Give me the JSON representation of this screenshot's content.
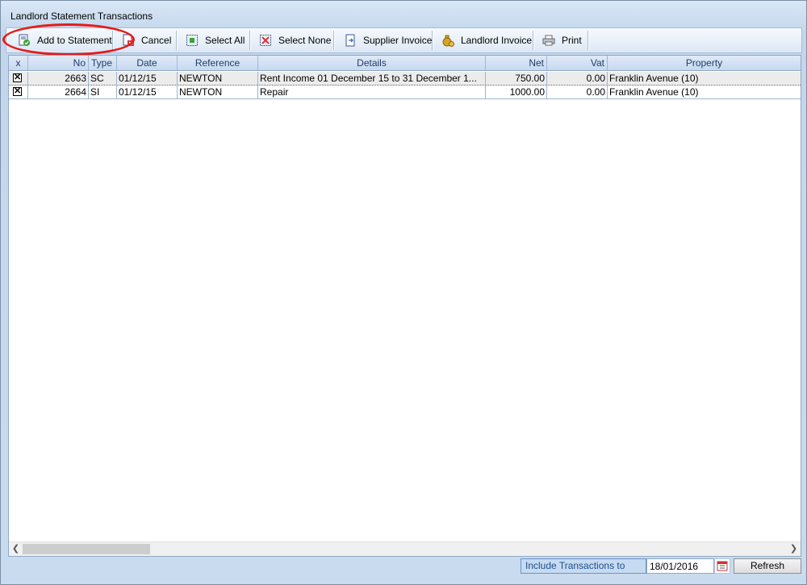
{
  "window": {
    "title": "Landlord Statement Transactions"
  },
  "toolbar": {
    "add_to_statement": "Add to Statement",
    "cancel": "Cancel",
    "select_all": "Select All",
    "select_none": "Select None",
    "supplier_invoice": "Supplier Invoice",
    "landlord_invoice": "Landlord Invoice",
    "print": "Print"
  },
  "grid": {
    "columns": [
      "x",
      "No",
      "Type",
      "Date",
      "Reference",
      "Details",
      "Net",
      "Vat",
      "Property"
    ],
    "rows": [
      {
        "checked": "✕",
        "no": "2663",
        "type": "SC",
        "date": "01/12/15",
        "reference": "NEWTON",
        "details": "Rent Income 01 December 15 to 31 December 1...",
        "net": "750.00",
        "vat": "0.00",
        "property": "Franklin Avenue (10)"
      },
      {
        "checked": "✕",
        "no": "2664",
        "type": "SI",
        "date": "01/12/15",
        "reference": "NEWTON",
        "details": "Repair",
        "net": "1000.00",
        "vat": "0.00",
        "property": "Franklin Avenue (10)"
      }
    ]
  },
  "footer": {
    "include_label": "Include Transactions to",
    "date_value": "18/01/2016",
    "refresh": "Refresh"
  },
  "colors": {
    "highlight": "#e41b17",
    "header_text": "#1f3d6b"
  }
}
